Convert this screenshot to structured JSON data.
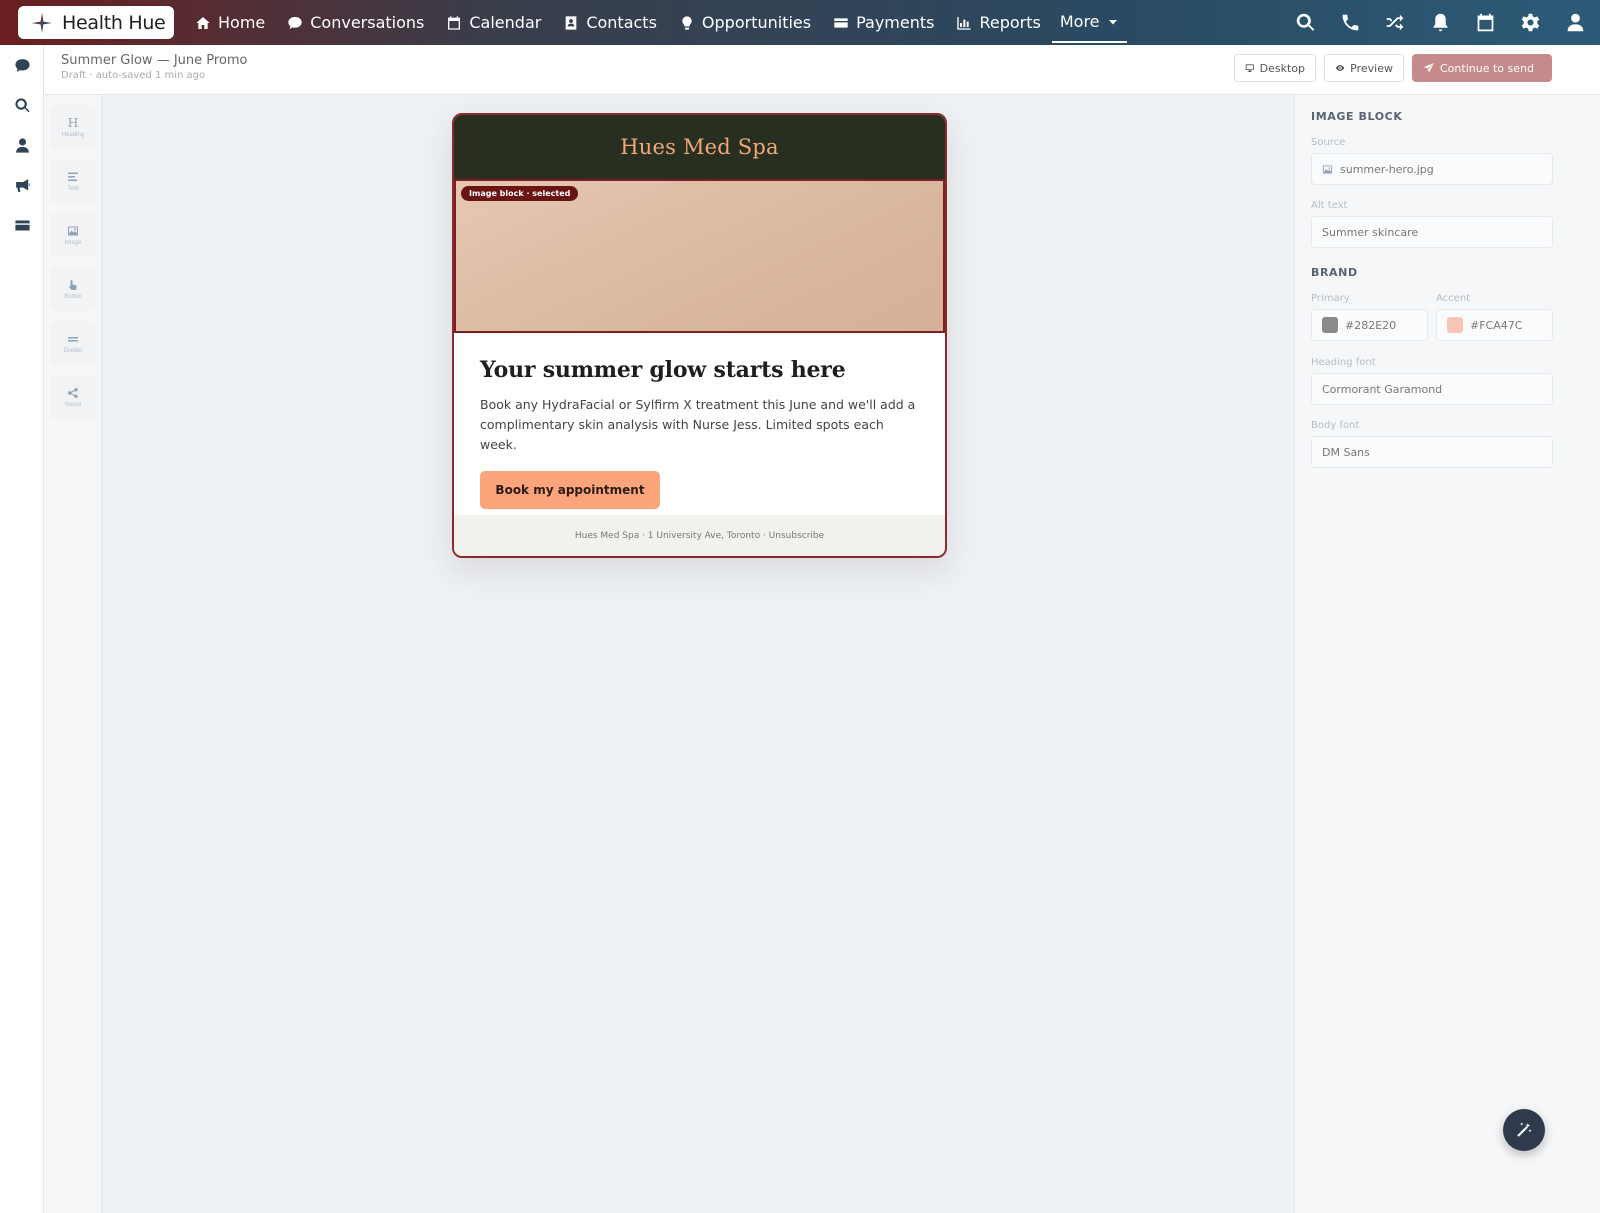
{
  "brand": {
    "name": "Health Hue"
  },
  "nav": {
    "items": [
      {
        "label": "Home",
        "icon": "home-icon"
      },
      {
        "label": "Conversations",
        "icon": "chat-icon"
      },
      {
        "label": "Calendar",
        "icon": "calendar-icon"
      },
      {
        "label": "Contacts",
        "icon": "contact-card-icon"
      },
      {
        "label": "Opportunities",
        "icon": "lightbulb-icon"
      },
      {
        "label": "Payments",
        "icon": "credit-card-icon"
      },
      {
        "label": "Reports",
        "icon": "bar-chart-icon"
      }
    ],
    "more_label": "More",
    "right_icons": [
      "search-icon",
      "phone-icon",
      "shuffle-icon",
      "bell-icon",
      "calendar-icon",
      "gear-icon",
      "user-icon"
    ]
  },
  "rail": {
    "icons": [
      "chat-icon",
      "search-icon",
      "user-icon",
      "megaphone-icon",
      "credit-card-icon"
    ]
  },
  "palette": {
    "items": [
      {
        "label": "Heading",
        "icon": "heading-icon"
      },
      {
        "label": "Text",
        "icon": "text-icon"
      },
      {
        "label": "Image",
        "icon": "image-icon"
      },
      {
        "label": "Button",
        "icon": "pointer-icon"
      },
      {
        "label": "Divider",
        "icon": "divider-icon"
      },
      {
        "label": "Social",
        "icon": "share-icon"
      }
    ]
  },
  "header": {
    "title": "Summer Glow — June Promo",
    "subtitle": "Draft · auto-saved 1 min ago",
    "desktop_label": "Desktop",
    "preview_label": "Preview",
    "send_label": "Continue to send"
  },
  "email": {
    "brand_name": "Hues Med Spa",
    "selected_badge": "Image block · selected",
    "headline": "Your summer glow starts here",
    "body": "Book any HydraFacial or Sylfirm X treatment this June and we'll add a complimentary skin analysis with Nurse Jess. Limited spots each week.",
    "cta": "Book my appointment",
    "footer": "Hues Med Spa · 1 University Ave, Toronto · Unsubscribe"
  },
  "panel": {
    "image_section": "IMAGE BLOCK",
    "source_label": "Source",
    "source_value": "summer-hero.jpg",
    "alt_label": "Alt text",
    "alt_value": "Summer skincare",
    "brand_section": "BRAND",
    "primary_label": "Primary",
    "primary_value": "#282E20",
    "accent_label": "Accent",
    "accent_value": "#FCA47C",
    "heading_font_label": "Heading font",
    "heading_font_value": "Cormorant Garamond",
    "body_font_label": "Body font",
    "body_font_value": "DM Sans"
  },
  "colors": {
    "primary": "#282E20",
    "accent": "#FCA47C",
    "primary_swatch": "#8a8a8a",
    "accent_swatch": "#f8c6b4",
    "send_button": "#c68a8a"
  }
}
